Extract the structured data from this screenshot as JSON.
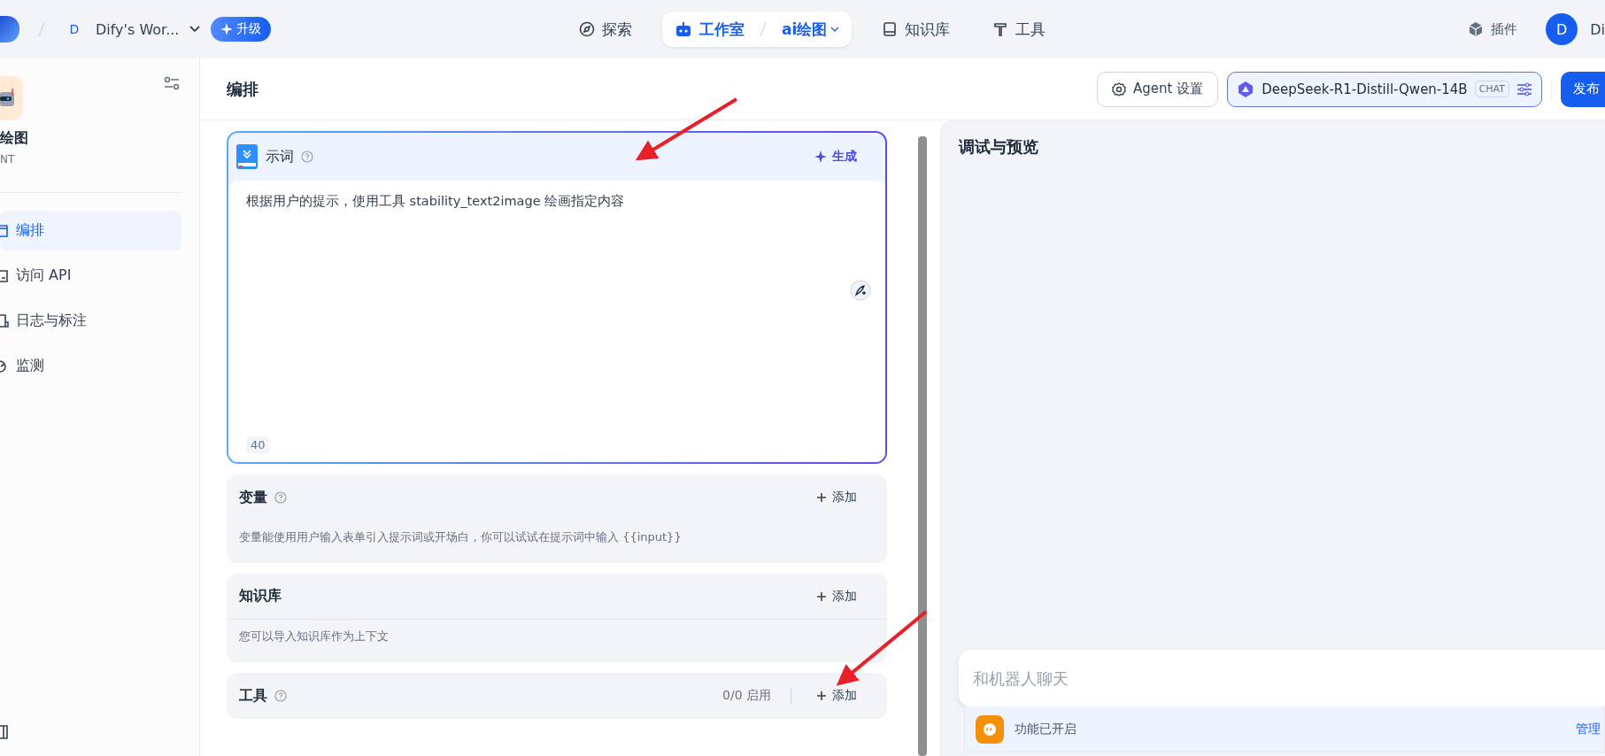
{
  "topbar": {
    "workspace_initial": "D",
    "workspace_name": "Dify's Wor...",
    "upgrade": "升级",
    "nav": [
      {
        "label": "探索",
        "kind": "explore",
        "selected": false
      },
      {
        "label": "工作室",
        "kind": "studio",
        "selected": true,
        "app": "ai绘图"
      },
      {
        "label": "知识库",
        "kind": "knowledge",
        "selected": false
      },
      {
        "label": "工具",
        "kind": "tools",
        "selected": false
      }
    ],
    "plugins": "插件",
    "user_initial": "D",
    "user_name": "Di"
  },
  "sidebar": {
    "app_name": "绘图",
    "app_mode": "NT",
    "items": [
      {
        "label": "编排",
        "kind": "orchestrate",
        "selected": true
      },
      {
        "label": "访问 API",
        "kind": "api",
        "selected": false
      },
      {
        "label": "日志与标注",
        "kind": "logs",
        "selected": false
      },
      {
        "label": "监测",
        "kind": "monitor",
        "selected": false
      }
    ]
  },
  "header": {
    "title": "编排",
    "agent_settings": "Agent 设置",
    "model": "DeepSeek-R1-Distill-Qwen-14B",
    "model_mode": "CHAT",
    "publish": "发布"
  },
  "prompt": {
    "title": "示词",
    "generate": "生成",
    "value": "根据用户的提示，使用工具 stability_text2image 绘画指定内容",
    "count": "40"
  },
  "sections": [
    {
      "title": "变量",
      "help": true,
      "add": "添加",
      "description": "变量能使用用户输入表单引入提示词或开场白，你可以试试在提示词中输入 {{input}}",
      "divider": false
    },
    {
      "title": "知识库",
      "help": false,
      "add": "添加",
      "description": "您可以导入知识库作为上下文",
      "divider": true
    },
    {
      "title": "工具",
      "help": true,
      "add": "添加",
      "status": "0/0 启用",
      "divider": false
    }
  ],
  "preview": {
    "title": "调试与预览",
    "chat_placeholder": "和机器人聊天",
    "features": "功能已开启",
    "manage": "管理"
  }
}
